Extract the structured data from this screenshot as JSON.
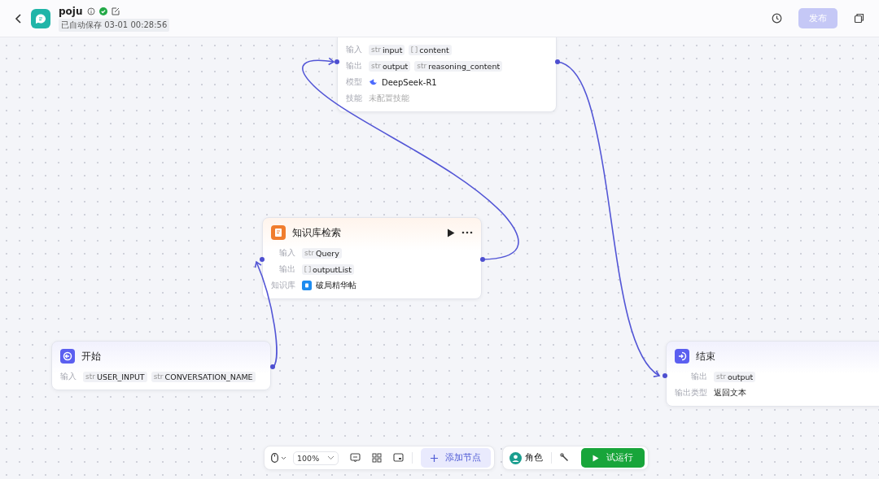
{
  "header": {
    "title": "poju",
    "saved": "已自动保存 03-01 00:28:56",
    "publish": {
      "label": "发布",
      "disabled": true
    }
  },
  "nodes": [
    {
      "kind": "llm",
      "rows": [
        {
          "label": "输入",
          "kind": "vars",
          "vars": [
            {
              "type": "str",
              "name": "input"
            },
            {
              "kind": "array",
              "name": "content"
            }
          ]
        },
        {
          "label": "输出",
          "kind": "vars",
          "vars": [
            {
              "type": "str",
              "name": "output"
            },
            {
              "type": "str",
              "name": "reasoning_content"
            }
          ]
        },
        {
          "label": "模型",
          "kind": "model",
          "value": "DeepSeek-R1"
        },
        {
          "label": "技能",
          "kind": "placeholder",
          "value": "未配置技能"
        }
      ]
    },
    {
      "kind": "knowledge",
      "title": "知识库检索",
      "rows": [
        {
          "label": "输入",
          "kind": "vars",
          "vars": [
            {
              "type": "str",
              "name": "Query"
            }
          ]
        },
        {
          "label": "输出",
          "kind": "vars",
          "vars": [
            {
              "kind": "array",
              "name": "outputList"
            }
          ]
        },
        {
          "label": "知识库",
          "kind": "kb",
          "value": "破局精华帖"
        }
      ]
    },
    {
      "kind": "start",
      "title": "开始",
      "rows": [
        {
          "label": "输入",
          "kind": "vars",
          "vars": [
            {
              "type": "str",
              "name": "USER_INPUT"
            },
            {
              "type": "str",
              "name": "CONVERSATION_NAME"
            }
          ]
        }
      ]
    },
    {
      "kind": "end",
      "title": "结束",
      "rows": [
        {
          "label": "输出",
          "kind": "vars",
          "vars": [
            {
              "type": "str",
              "name": "output"
            }
          ]
        },
        {
          "label": "输出类型",
          "kind": "text",
          "value": "返回文本"
        }
      ]
    }
  ],
  "toolbar": {
    "zoom": "100%",
    "add_node": "添加节点",
    "role": "角色",
    "run": "试运行"
  }
}
